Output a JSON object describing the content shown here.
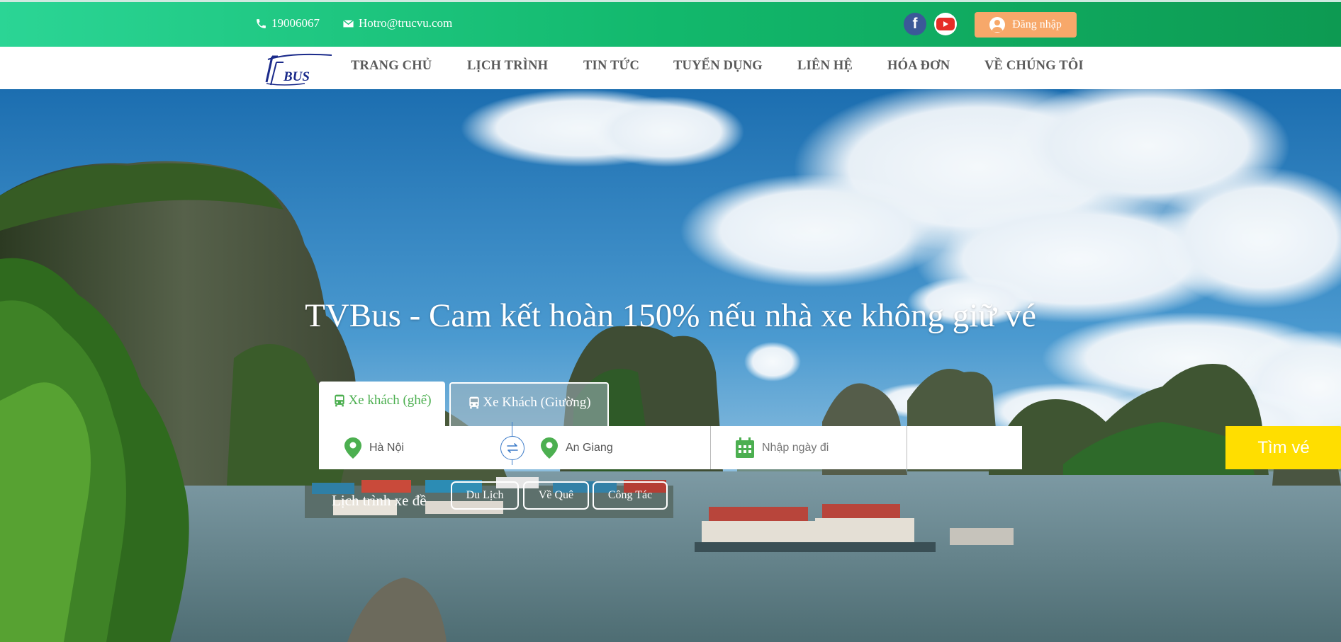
{
  "topbar": {
    "phone": "19006067",
    "email": "Hotro@trucvu.com",
    "login_label": "Đăng nhập",
    "social": [
      "facebook-icon",
      "youtube-icon"
    ]
  },
  "nav": {
    "logo_text": "BUS",
    "items": [
      "TRANG CHỦ",
      "LỊCH TRÌNH",
      "TIN TỨC",
      "TUYỂN DỤNG",
      "LIÊN HỆ",
      "HÓA ĐƠN",
      "VỀ CHÚNG TÔI"
    ]
  },
  "hero": {
    "headline": "TVBus - Cam kết hoàn 150% nếu nhà xe không giữ vé",
    "tabs": [
      {
        "label": "Xe khách (ghế)",
        "icon": "bus-icon",
        "active": true
      },
      {
        "label": "Xe Khách (Giường)",
        "icon": "bus-icon",
        "active": false
      }
    ],
    "search": {
      "from_value": "Hà Nội",
      "to_value": "An Giang",
      "date_placeholder": "Nhập ngày đi",
      "button_label": "Tìm vé"
    },
    "trip_label": "Lịch trình xe đề",
    "chips": [
      "Du Lịch",
      "Về Quê",
      "Công Tác"
    ]
  },
  "colors": {
    "topbar_start": "#2bd595",
    "topbar_end": "#0d9a52",
    "accent_green": "#4caf50",
    "search_button": "#ffde00",
    "login_button": "#f7a86a"
  }
}
